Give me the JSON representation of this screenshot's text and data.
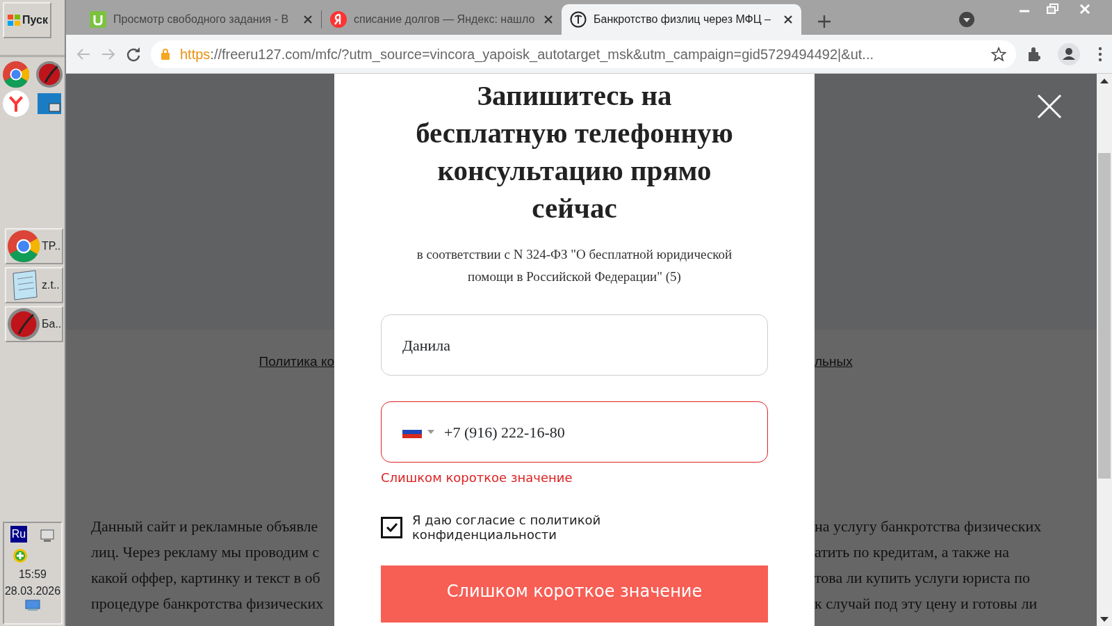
{
  "taskbar": {
    "start_label": "Пуск",
    "quick_launch": [
      {
        "kind": "chrome"
      },
      {
        "kind": "opera"
      },
      {
        "kind": "yandex"
      },
      {
        "kind": "photo"
      }
    ],
    "tasks": [
      {
        "kind": "chrome",
        "label": "TP.."
      },
      {
        "kind": "notepad",
        "label": "z.t.."
      },
      {
        "kind": "opera",
        "label": "Ба.."
      }
    ],
    "tray": {
      "language": "Ru",
      "time": "15:59",
      "date": "28.03.2026"
    }
  },
  "browser": {
    "tabs": [
      {
        "kind": "u",
        "title": "Просмотр свободного задания - В",
        "selected": false
      },
      {
        "kind": "yandex",
        "title": "списание долгов — Яндекс: нашло",
        "selected": false
      },
      {
        "kind": "site",
        "title": "Банкротство физлиц через МФЦ –",
        "selected": true
      }
    ],
    "address": {
      "scheme": "https",
      "rest": "://freeru127.com/mfc/?utm_source=vincora_yapoisk_autotarget_msk&utm_campaign=gid5729494492|&ut..."
    }
  },
  "page": {
    "policy_link_left": "Политика ко",
    "policy_link_right": "льных",
    "paragraph_left": [
      "Данный сайт и рекламные объявле",
      "лиц. Через рекламу мы проводим с",
      "какой оффер, картинку и текст в об",
      "процедуре банкротства физических"
    ],
    "paragraph_right": [
      "на услугу банкротства физических",
      "атить по кредитам, а также на",
      "това ли купить услуги юриста по",
      "к случай под эту цену и готовы ли"
    ]
  },
  "modal": {
    "title_lines": [
      "Запишитесь на",
      "бесплатную телефонную",
      "консультацию прямо",
      "сейчас"
    ],
    "subtitle": "в соответствии с N 324-ФЗ \"О бесплатной юридической помощи в Российской Федерации\" (5)",
    "name_value": "Данила",
    "phone_value": "+7 (916) 222-16-80",
    "phone_invalid": true,
    "phone_error": "Слишком короткое значение",
    "consent": {
      "label": "Я даю согласие с политикой конфиденциальности",
      "checked": true
    },
    "submit_label": "Слишком короткое значение"
  }
}
